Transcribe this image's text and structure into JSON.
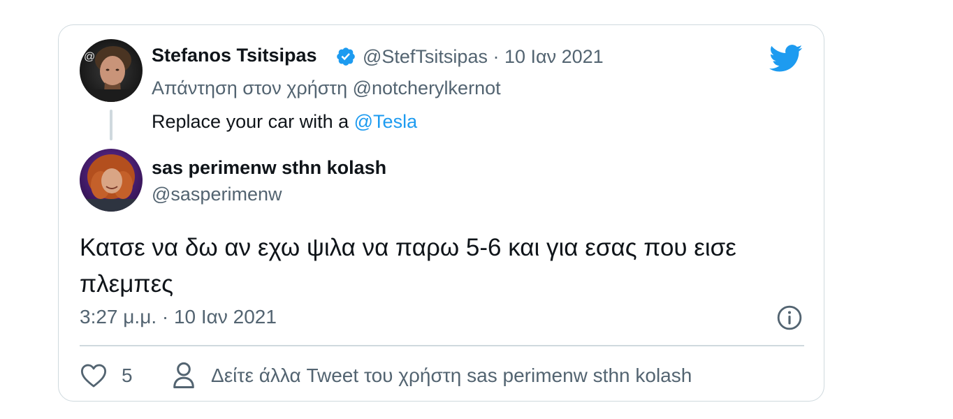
{
  "original_tweet": {
    "author_name": "Stefanos Tsitsipas",
    "handle": "@StefTsitsipas",
    "separator": " · ",
    "date": "10 Ιαν 2021",
    "reply_prefix": "Απάντηση στον χρήστη ",
    "reply_to": "@notcherylkernot",
    "text_prefix": "Replace your car with a ",
    "text_mention": "@Tesla",
    "verified": true,
    "avatar_icon": "profile-photo"
  },
  "quote_tweet": {
    "author_name": "sas perimenw sthn kolash",
    "handle": "@sasperimenw",
    "text": "Κατσε να δω αν εχω ψιλα να παρω 5-6 και για εσας που εισε πλεμπες",
    "timestamp": "3:27 μ.μ. · 10 Ιαν 2021",
    "avatar_icon": "profile-photo"
  },
  "actions": {
    "like_count": "5",
    "more_tweets_label": "Δείτε άλλα Tweet του χρήστη sas perimenw sthn kolash"
  },
  "colors": {
    "accent": "#1d9bf0",
    "secondary_text": "#536471",
    "border": "#cfd9de"
  },
  "icons": [
    "verified-badge-icon",
    "twitter-bird-icon",
    "info-icon",
    "heart-icon",
    "person-icon"
  ]
}
